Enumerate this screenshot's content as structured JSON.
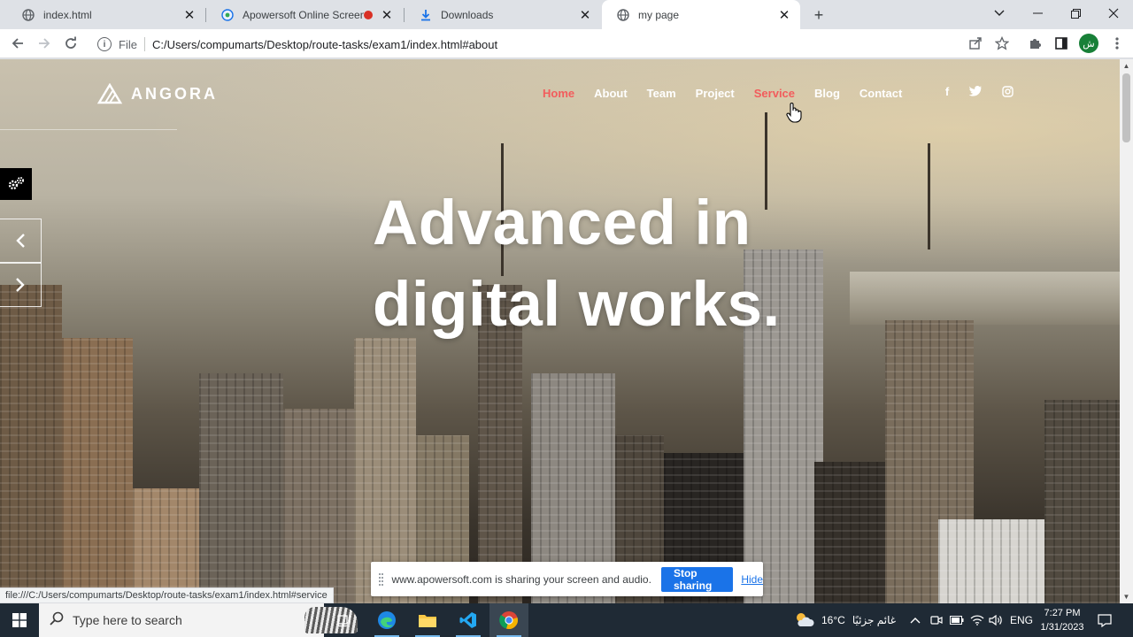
{
  "browser": {
    "tabs": [
      {
        "title": "index.html",
        "icon": "globe-icon"
      },
      {
        "title": "Apowersoft Online Screen Re",
        "icon": "apowersoft-icon",
        "recording": true
      },
      {
        "title": "Downloads",
        "icon": "download-icon"
      },
      {
        "title": "my page",
        "icon": "globe-icon",
        "active": true
      }
    ],
    "omnibox": {
      "scheme_label": "File",
      "url": "C:/Users/compumarts/Desktop/route-tasks/exam1/index.html#about"
    },
    "profile_initial": "ش",
    "status_url": "file:///C:/Users/compumarts/Desktop/route-tasks/exam1/index.html#service"
  },
  "page": {
    "brand": "ANGORA",
    "nav": [
      {
        "label": "Home",
        "state": "active"
      },
      {
        "label": "About"
      },
      {
        "label": "Team"
      },
      {
        "label": "Project"
      },
      {
        "label": "Service",
        "state": "hover"
      },
      {
        "label": "Blog"
      },
      {
        "label": "Contact"
      }
    ],
    "social": [
      "facebook-icon",
      "twitter-icon",
      "instagram-icon"
    ],
    "headline_line1": "Advanced in",
    "headline_line2": "digital works.",
    "accent_color": "#f25c5c"
  },
  "share_bar": {
    "message": "www.apowersoft.com is sharing your screen and audio.",
    "stop_label": "Stop sharing",
    "hide_label": "Hide"
  },
  "taskbar": {
    "search_placeholder": "Type here to search",
    "weather": "16°C",
    "weather_desc": "غائم جزئيًا",
    "language": "ENG",
    "time": "7:27 PM",
    "date": "1/31/2023"
  }
}
